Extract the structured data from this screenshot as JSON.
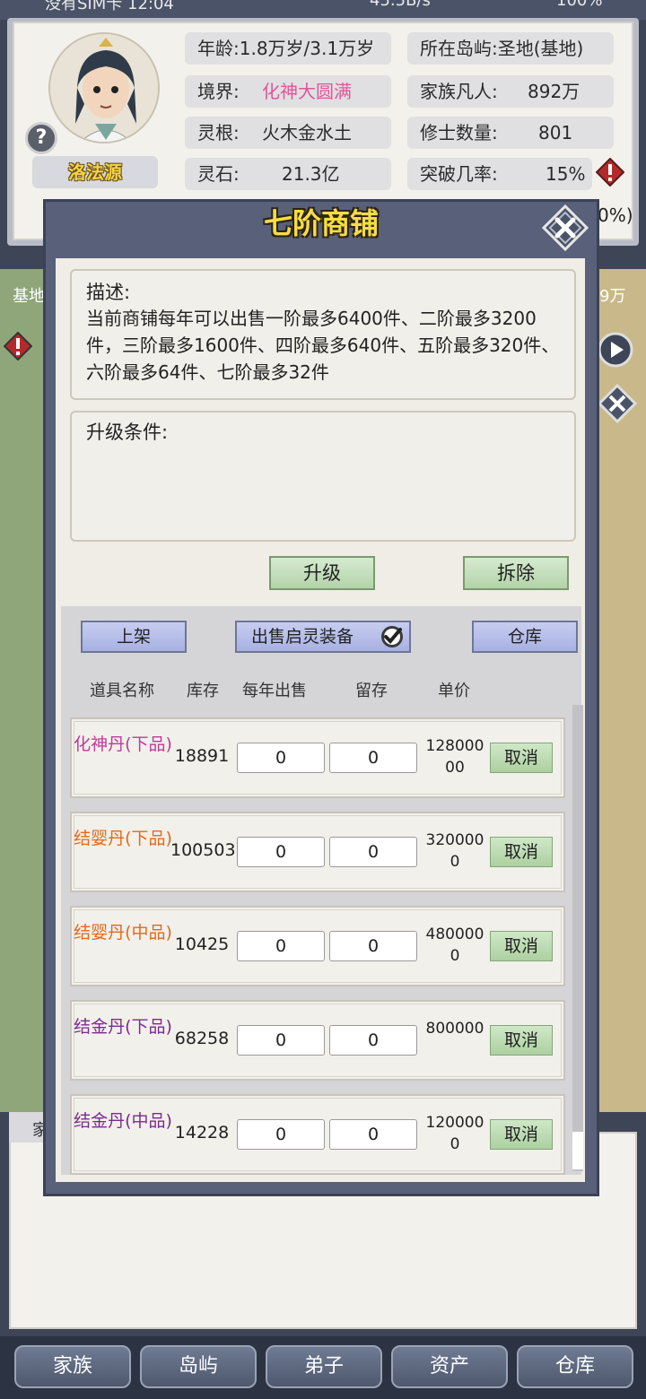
{
  "status": {
    "left": "没有SIM卡 12:04",
    "mid": "45.5B/s",
    "right": "100%"
  },
  "profile": {
    "name": "洛法源",
    "help": "?",
    "age_label": "年龄:",
    "age_value": "1.8万岁/3.1万岁",
    "realm_label": "境界:",
    "realm_value": "化神大圆满",
    "root_label": "灵根:",
    "root_value": "火木金水土",
    "stone_label": "灵石:",
    "stone_value": "21.3亿",
    "island_label": "所在岛屿:",
    "island_value": "圣地(基地)",
    "mortals_label": "家族凡人:",
    "mortals_value": "892万",
    "cultivators_label": "修士数量:",
    "cultivators_value": "801",
    "breakthrough_label": "突破几率:",
    "breakthrough_value": "15%",
    "hidden_tail": "0%)"
  },
  "map": {
    "left_label": "基地",
    "right_label": "9万"
  },
  "lower_tab": "家",
  "modal": {
    "title": "七阶商铺",
    "desc_title": "描述:",
    "desc_text": "当前商铺每年可以出售一阶最多6400件、二阶最多3200件，三阶最多1600件、四阶最多640件、五阶最多320件、六阶最多64件、七阶最多32件",
    "upgrade_cond_title": "升级条件:",
    "upgrade_btn": "升级",
    "demolish_btn": "拆除",
    "list_btn": "上架",
    "sell_equipment_btn": "出售启灵装备",
    "warehouse_btn": "仓库",
    "columns": [
      "道具名称",
      "库存",
      "每年出售",
      "留存",
      "单价"
    ],
    "cancel_label": "取消",
    "rows": [
      {
        "name": "化神丹(下品)",
        "color": "#c0399a",
        "stock": "18891",
        "sell": "0",
        "keep": "0",
        "price": "12800000"
      },
      {
        "name": "结婴丹(下品)",
        "color": "#e06a1e",
        "stock": "100503",
        "sell": "0",
        "keep": "0",
        "price": "3200000"
      },
      {
        "name": "结婴丹(中品)",
        "color": "#e06a1e",
        "stock": "10425",
        "sell": "0",
        "keep": "0",
        "price": "4800000"
      },
      {
        "name": "结金丹(下品)",
        "color": "#7a2b8f",
        "stock": "68258",
        "sell": "0",
        "keep": "0",
        "price": "800000"
      },
      {
        "name": "结金丹(中品)",
        "color": "#7a2b8f",
        "stock": "14228",
        "sell": "0",
        "keep": "0",
        "price": "1200000"
      }
    ]
  },
  "nav": [
    "家族",
    "岛屿",
    "弟子",
    "资产",
    "仓库"
  ]
}
